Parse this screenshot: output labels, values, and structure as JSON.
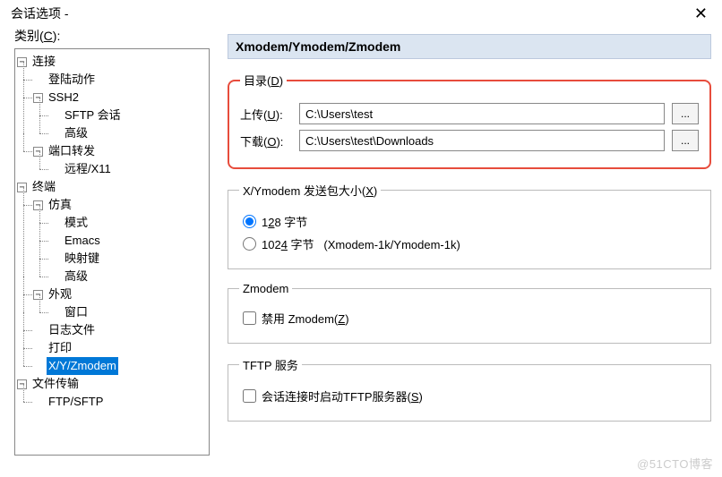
{
  "window": {
    "title": "会话选项 -"
  },
  "category_label": "类别(C):",
  "tree": {
    "connection": "连接",
    "login": "登陆动作",
    "ssh2": "SSH2",
    "sftp": "SFTP 会话",
    "advanced1": "高级",
    "portfwd": "端口转发",
    "remotex11": "远程/X11",
    "terminal": "终端",
    "emulation": "仿真",
    "mode": "模式",
    "emacs": "Emacs",
    "keymap": "映射键",
    "advanced2": "高级",
    "appearance": "外观",
    "window": "窗口",
    "logfile": "日志文件",
    "print": "打印",
    "xyz": "X/Y/Zmodem",
    "filetransfer": "文件传输",
    "ftpsftp": "FTP/SFTP"
  },
  "panel": {
    "heading": "Xmodem/Ymodem/Zmodem",
    "dir_legend": "目录(D)",
    "upload_label": "上传(U):",
    "upload_value": "C:\\Users\\test",
    "download_label": "下载(O):",
    "download_value": "C:\\Users\\test\\Downloads",
    "browse": "...",
    "packet_legend": "X/Ymodem 发送包大小(X)",
    "pkt128": "128 字节",
    "pkt1024": "1024 字节   (Xmodem-1k/Ymodem-1k)",
    "zmodem_legend": "Zmodem",
    "disable_zmodem": "禁用 Zmodem(Z)",
    "tftp_legend": "TFTP 服务",
    "tftp_start": "会话连接时启动TFTP服务器(S)"
  },
  "watermark": "@51CTO博客"
}
